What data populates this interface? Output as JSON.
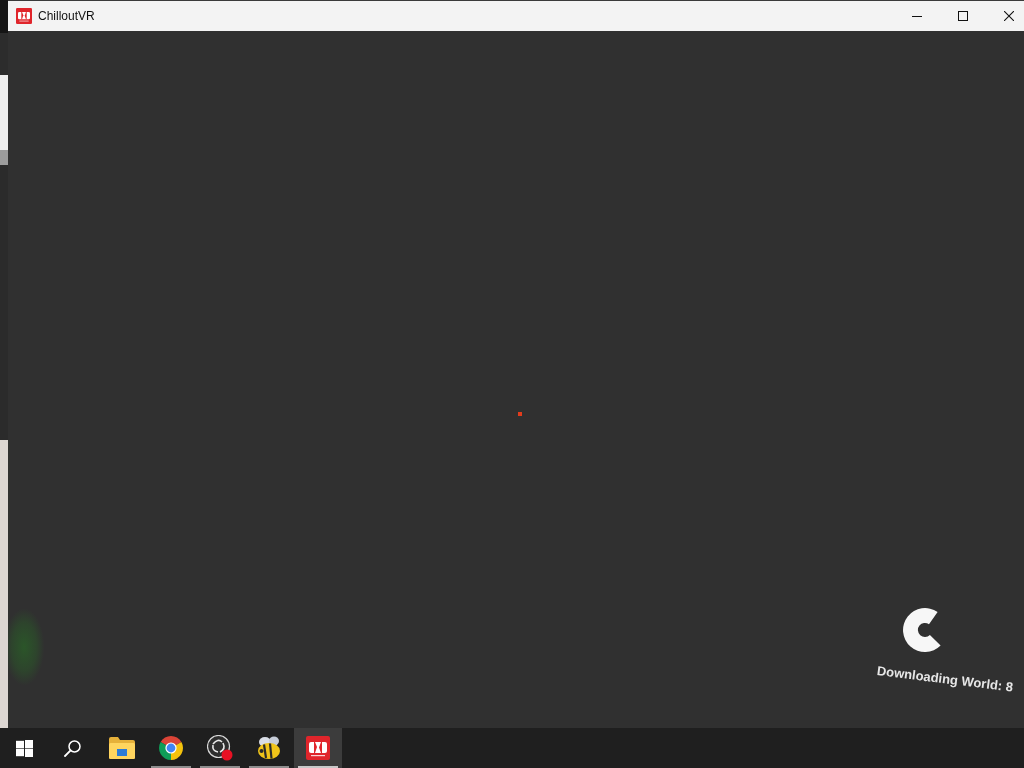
{
  "window": {
    "title": "ChilloutVR"
  },
  "viewport": {
    "loading_text": "Downloading World: 8"
  },
  "taskbar": {
    "items": [
      {
        "kind": "start",
        "running": false,
        "selected": false
      },
      {
        "kind": "search",
        "running": false,
        "selected": false
      },
      {
        "kind": "folder",
        "running": false,
        "selected": false
      },
      {
        "kind": "browser",
        "running": true,
        "selected": false
      },
      {
        "kind": "recorder",
        "running": true,
        "selected": false
      },
      {
        "kind": "bee",
        "running": true,
        "selected": false
      },
      {
        "kind": "app",
        "running": true,
        "selected": true
      }
    ]
  }
}
